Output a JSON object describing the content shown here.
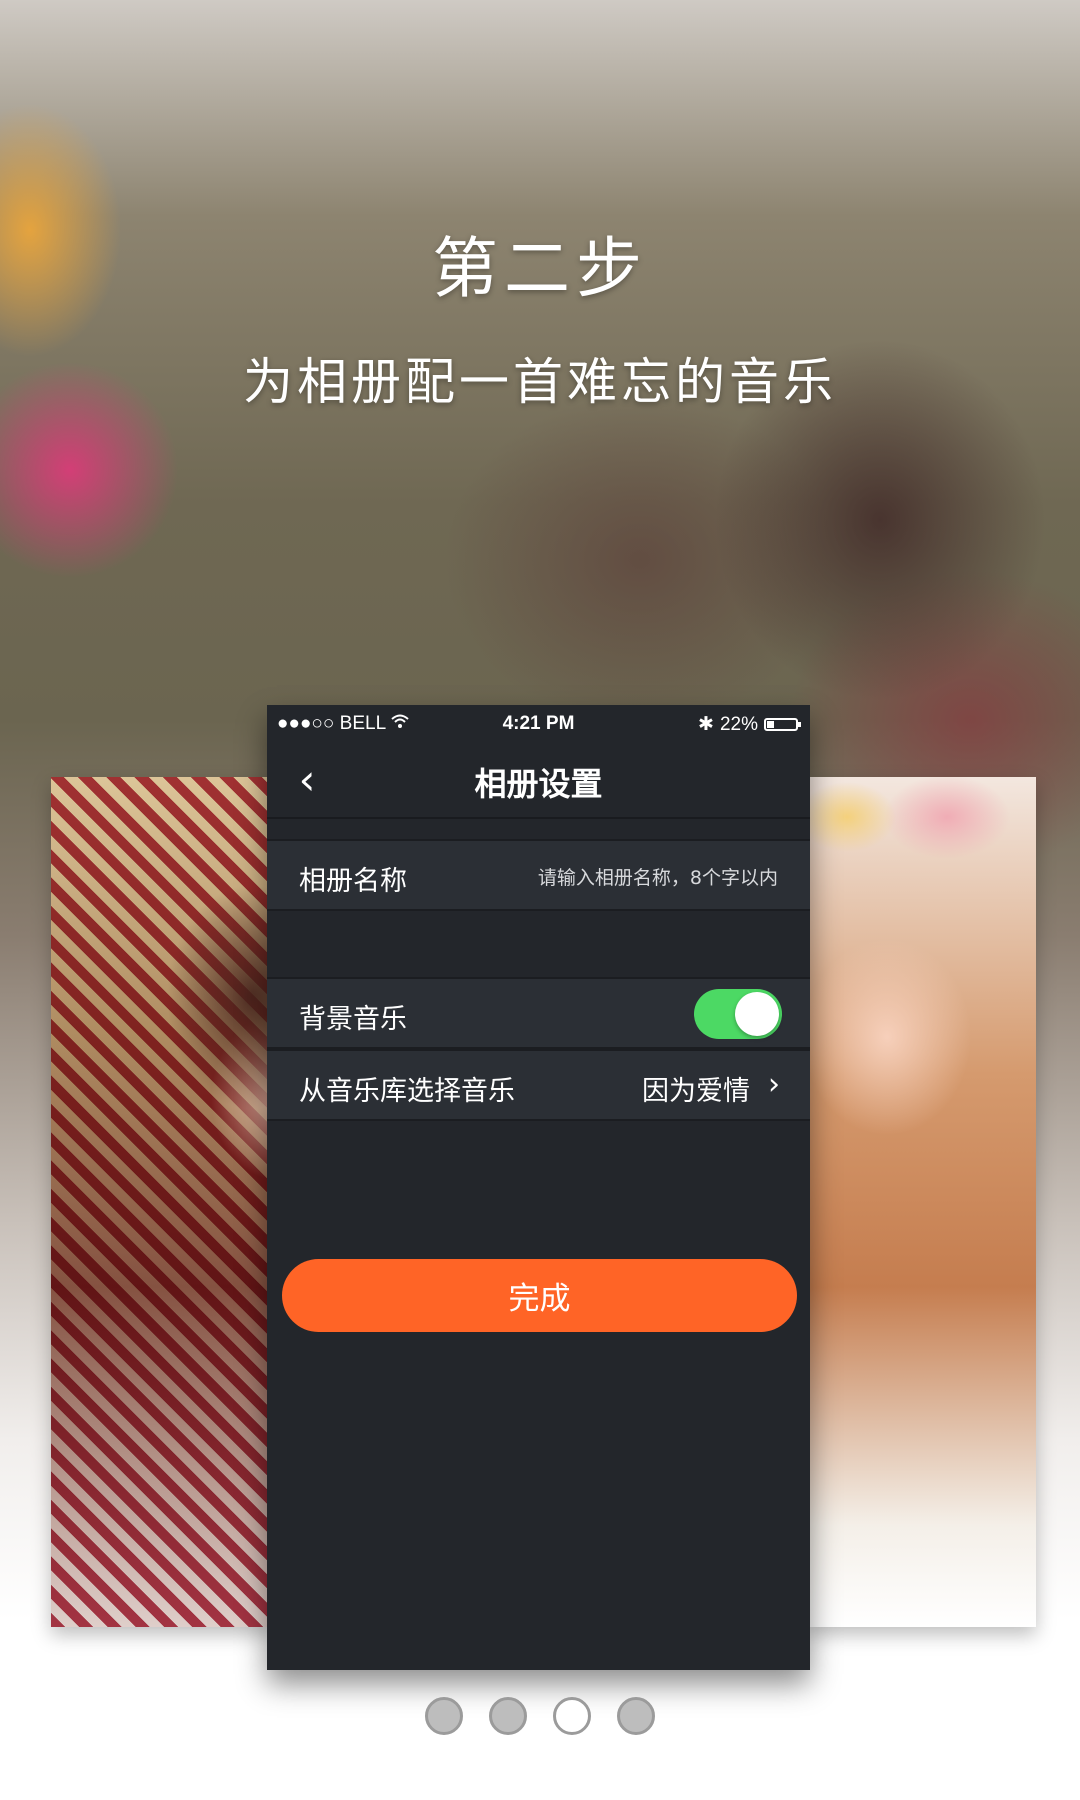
{
  "header": {
    "title": "第二步",
    "subtitle": "为相册配一首难忘的音乐"
  },
  "phone": {
    "status_bar": {
      "carrier": "●●●○○ BELL",
      "time": "4:21 PM",
      "bluetooth": "✱",
      "battery": "22%",
      "battery_level": 0.22
    },
    "nav": {
      "back_icon": "chevron-left-icon",
      "back_glyph": "‹",
      "title": "相册设置"
    },
    "album_name": {
      "label": "相册名称",
      "placeholder": "请输入相册名称，8个字以内"
    },
    "music": {
      "toggle_label": "背景音乐",
      "toggle_on": true,
      "library_label": "从音乐库选择音乐",
      "selected_song": "因为爱情",
      "chevron": "›"
    }
  },
  "done_button": "完成",
  "pagination": {
    "count": 4,
    "active_index": 2
  },
  "colors": {
    "screen_bg": "#23262b",
    "row_bg": "#2b2f35",
    "toggle_on": "#4cd964",
    "primary_button": "#ff6426"
  }
}
